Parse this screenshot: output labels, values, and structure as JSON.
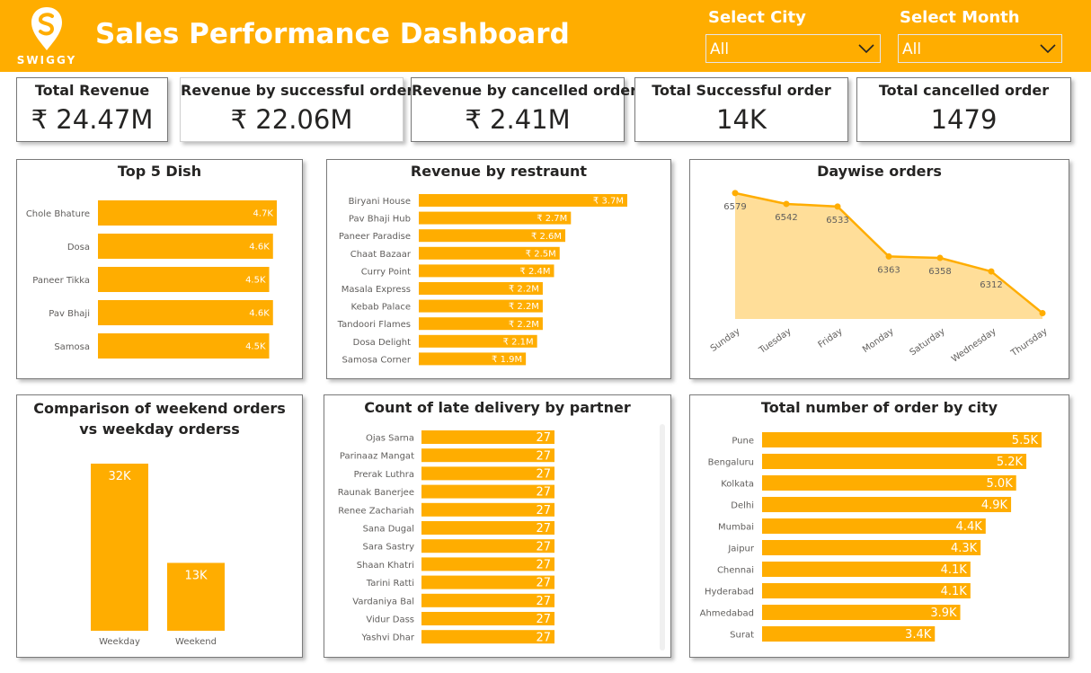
{
  "header": {
    "title": "Sales Performance Dashboard",
    "logo_text": "SWIGGY",
    "city_label": "Select City",
    "city_value": "All",
    "month_label": "Select Month",
    "month_value": "All",
    "color_brand": "#ffad00"
  },
  "cards": [
    {
      "label": "Total Revenue",
      "value": "₹ 24.47M"
    },
    {
      "label": "Revenue by successful order",
      "value": "₹ 22.06M"
    },
    {
      "label": "Revenue by cancelled order",
      "value": "₹ 2.41M"
    },
    {
      "label": "Total Successful order",
      "value": "14K"
    },
    {
      "label": "Total cancelled order",
      "value": "1479"
    }
  ],
  "chart_data": [
    {
      "id": "top5",
      "type": "bar",
      "orientation": "horizontal",
      "title": "Top 5 Dish",
      "categories": [
        "Chole Bhature",
        "Dosa",
        "Paneer Tikka",
        "Pav Bhaji",
        "Samosa"
      ],
      "values": [
        4700,
        4600,
        4500,
        4600,
        4500
      ],
      "labels": [
        "4.7K",
        "4.6K",
        "4.5K",
        "4.6K",
        "4.5K"
      ],
      "color": "#ffad00"
    },
    {
      "id": "restaurant",
      "type": "bar",
      "orientation": "horizontal",
      "title": "Revenue by restraunt",
      "categories": [
        "Biryani House",
        "Pav Bhaji Hub",
        "Paneer Paradise",
        "Chaat Bazaar",
        "Curry Point",
        "Masala Express",
        "Kebab Palace",
        "Tandoori Flames",
        "Dosa Delight",
        "Samosa Corner"
      ],
      "values": [
        3.7,
        2.7,
        2.6,
        2.5,
        2.4,
        2.2,
        2.2,
        2.2,
        2.1,
        1.9
      ],
      "labels": [
        "₹ 3.7M",
        "₹ 2.7M",
        "₹ 2.6M",
        "₹ 2.5M",
        "₹ 2.4M",
        "₹ 2.2M",
        "₹ 2.2M",
        "₹ 2.2M",
        "₹ 2.1M",
        "₹ 1.9M"
      ],
      "color": "#ffad00"
    },
    {
      "id": "daywise",
      "type": "area",
      "title": "Daywise orders",
      "x": [
        "Sunday",
        "Tuesday",
        "Friday",
        "Monday",
        "Saturday",
        "Wednesday",
        "Thursday"
      ],
      "values": [
        6579,
        6542,
        6533,
        6363,
        6358,
        6312,
        6170
      ],
      "labels": [
        "6579",
        "6542",
        "6533",
        "6363",
        "6358",
        "6312",
        ""
      ],
      "ylim": [
        6150,
        6600
      ],
      "color": "#ffad00"
    },
    {
      "id": "weekend",
      "type": "bar",
      "orientation": "vertical",
      "title": "Comparison of weekend orders vs weekday orderss",
      "categories": [
        "Weekday",
        "Weekend"
      ],
      "values": [
        32000,
        13000
      ],
      "labels": [
        "32K",
        "13K"
      ],
      "color": "#ffad00"
    },
    {
      "id": "late",
      "type": "bar",
      "orientation": "horizontal",
      "title": "Count of late delivery by partner",
      "categories": [
        "Ojas Sarna",
        "Parinaaz Mangat",
        "Prerak Luthra",
        "Raunak Banerjee",
        "Renee Zachariah",
        "Sana Dugal",
        "Sara Sastry",
        "Shaan Khatri",
        "Tarini Ratti",
        "Vardaniya Bal",
        "Vidur Dass",
        "Yashvi Dhar"
      ],
      "values": [
        27,
        27,
        27,
        27,
        27,
        27,
        27,
        27,
        27,
        27,
        27,
        27
      ],
      "labels": [
        "27",
        "27",
        "27",
        "27",
        "27",
        "27",
        "27",
        "27",
        "27",
        "27",
        "27",
        "27"
      ],
      "color": "#ffad00"
    },
    {
      "id": "city",
      "type": "bar",
      "orientation": "horizontal",
      "title": "Total number of order by city",
      "categories": [
        "Pune",
        "Bengaluru",
        "Kolkata",
        "Delhi",
        "Mumbai",
        "Jaipur",
        "Chennai",
        "Hyderabad",
        "Ahmedabad",
        "Surat"
      ],
      "values": [
        5500,
        5200,
        5000,
        4900,
        4400,
        4300,
        4100,
        4100,
        3900,
        3400
      ],
      "labels": [
        "5.5K",
        "5.2K",
        "5.0K",
        "4.9K",
        "4.4K",
        "4.3K",
        "4.1K",
        "4.1K",
        "3.9K",
        "3.4K"
      ],
      "color": "#ffad00"
    }
  ]
}
